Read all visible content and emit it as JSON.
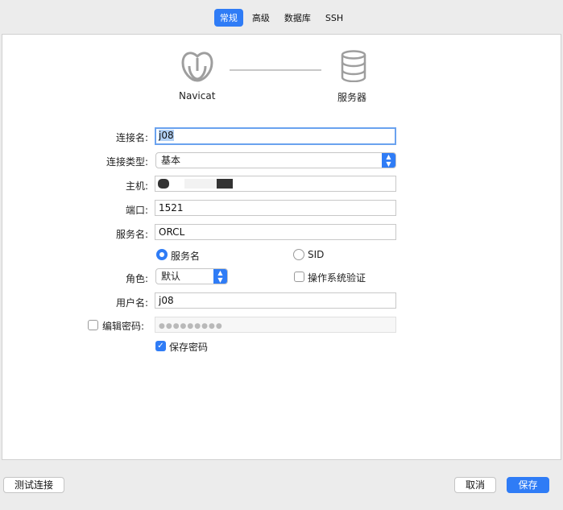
{
  "tabs": [
    "常规",
    "高级",
    "数据库",
    "SSH"
  ],
  "diagram": {
    "left_label": "Navicat",
    "right_label": "服务器"
  },
  "form": {
    "connection_name_label": "连接名:",
    "connection_name_value": "j08",
    "connection_type_label": "连接类型:",
    "connection_type_value": "基本",
    "host_label": "主机:",
    "port_label": "端口:",
    "port_value": "1521",
    "service_name_label": "服务名:",
    "service_name_value": "ORCL",
    "radio_service_name": "服务名",
    "radio_sid": "SID",
    "role_label": "角色:",
    "role_value": "默认",
    "os_auth_label": "操作系统验证",
    "username_label": "用户名:",
    "username_value": "j08",
    "edit_password_label": "编辑密码:",
    "password_mask": "●●●●●●●●●",
    "save_password_label": "保存密码"
  },
  "footer": {
    "test_label": "测试连接",
    "cancel_label": "取消",
    "save_label": "保存"
  },
  "colors": {
    "accent": "#2f7cf6"
  }
}
